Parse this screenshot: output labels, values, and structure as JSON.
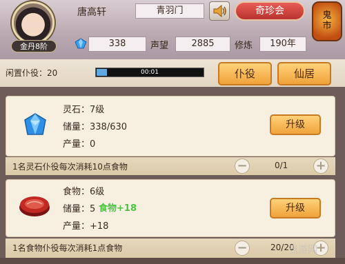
{
  "player": {
    "name": "唐高轩",
    "sect": "青羽门",
    "rank": "金丹8阶"
  },
  "header": {
    "treasure_button": "奇珍会",
    "market_lantern": "鬼市",
    "spirit_stones": "338",
    "reputation_label": "声望",
    "reputation": "2885",
    "cultivation_label": "修炼",
    "cultivation": "190年"
  },
  "servants": {
    "idle_label": "闲置仆役：20",
    "timer": "00:01",
    "timer_progress": 0.1,
    "servant_button": "仆役",
    "residence_button": "仙居"
  },
  "resources": [
    {
      "name_level": "灵石：7级",
      "storage": "储量：338/630",
      "output": "产量：0",
      "upgrade": "升级",
      "footer": "1名灵石仆役每次消耗10点食物",
      "count": "0/1",
      "icon": "blue-crystal-icon"
    },
    {
      "name_level": "食物：6级",
      "storage": "储量：5",
      "output": "产量：+18",
      "upgrade": "升级",
      "footer": "1名食物仆役每次消耗1点食物",
      "count": "20/20",
      "icon": "meat-icon",
      "float_text": "食物+18"
    }
  ],
  "watermark": "当游网",
  "colors": {
    "accent_orange": "#f0a23a",
    "treasure_red": "#c8403a",
    "float_green": "#4ac23a"
  }
}
